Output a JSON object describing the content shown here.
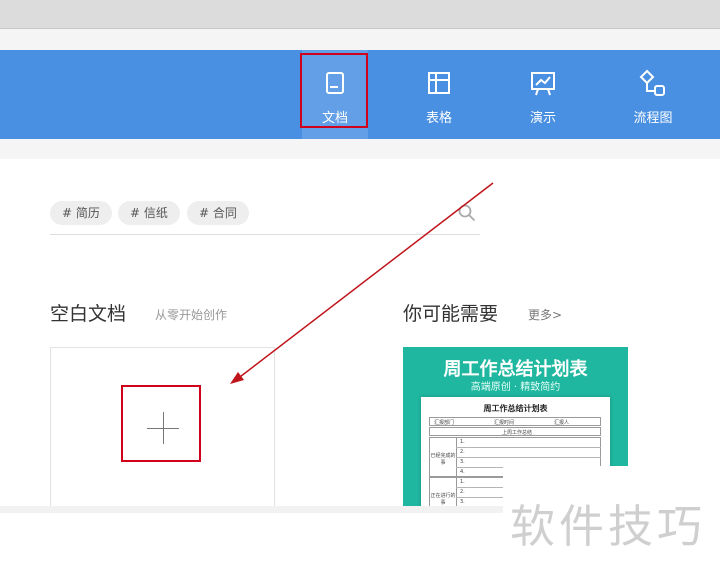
{
  "nav": {
    "items": [
      {
        "label": "文档",
        "icon": "document-icon",
        "selected": true
      },
      {
        "label": "表格",
        "icon": "table-icon"
      },
      {
        "label": "演示",
        "icon": "presentation-icon"
      },
      {
        "label": "流程图",
        "icon": "flowchart-icon"
      }
    ]
  },
  "tags": [
    "# 简历",
    "# 信纸",
    "# 合同"
  ],
  "blank_section": {
    "title": "空白文档",
    "subtitle": "从零开始创作"
  },
  "suggest_section": {
    "title": "你可能需要",
    "more": "更多>"
  },
  "template": {
    "title": "周工作总结计划表",
    "subtitle": "高端原创 · 精致简约",
    "sheet_title": "周工作总结计划表",
    "header_cells": [
      "汇报部门",
      "汇报时间",
      "汇报人"
    ],
    "section_label": "上周工作总结",
    "block1_label": "已经完成的事",
    "block2_label": "正在进行的事",
    "nums": [
      "1.",
      "2.",
      "3.",
      "4."
    ]
  },
  "watermark": "软件技巧",
  "colors": {
    "nav_bg": "#4a90e2",
    "highlight": "#d0021b",
    "template_bg": "#1fb79f"
  }
}
